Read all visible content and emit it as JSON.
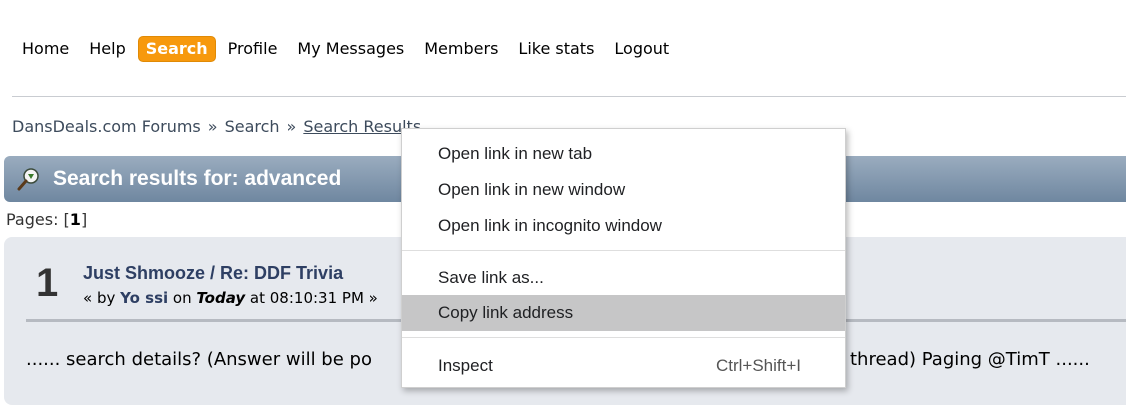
{
  "nav": {
    "items": [
      {
        "label": "Home"
      },
      {
        "label": "Help"
      },
      {
        "label": "Search"
      },
      {
        "label": "Profile"
      },
      {
        "label": "My Messages"
      },
      {
        "label": "Members"
      },
      {
        "label": "Like stats"
      },
      {
        "label": "Logout"
      }
    ],
    "active_color": "#f7990d"
  },
  "breadcrumb": {
    "items": [
      "DansDeals.com Forums",
      "Search",
      "Search Results"
    ],
    "separator": "»"
  },
  "header": {
    "title": "Search results for: advanced",
    "icon": "search-results-icon"
  },
  "pages": {
    "label": "Pages: [",
    "current": "1",
    "close": "]"
  },
  "result": {
    "number": "1",
    "board": "Just Shmooze",
    "slash": " / ",
    "subject": "Re: DDF Trivia",
    "meta_prefix": "« by ",
    "user": "Yo ssi",
    "meta_on": " on ",
    "today": "Today",
    "meta_time": " at 08:10:31 PM »",
    "body_left": "......  search details?  (Answer will be po",
    "body_right": "thread)   Paging @TimT  ......"
  },
  "context_menu": {
    "items": [
      {
        "label": "Open link in new tab"
      },
      {
        "label": "Open link in new window"
      },
      {
        "label": "Open link in incognito window"
      },
      {
        "label": "Save link as..."
      },
      {
        "label": "Copy link address"
      },
      {
        "label": "Inspect",
        "shortcut": "Ctrl+Shift+I"
      }
    ]
  }
}
